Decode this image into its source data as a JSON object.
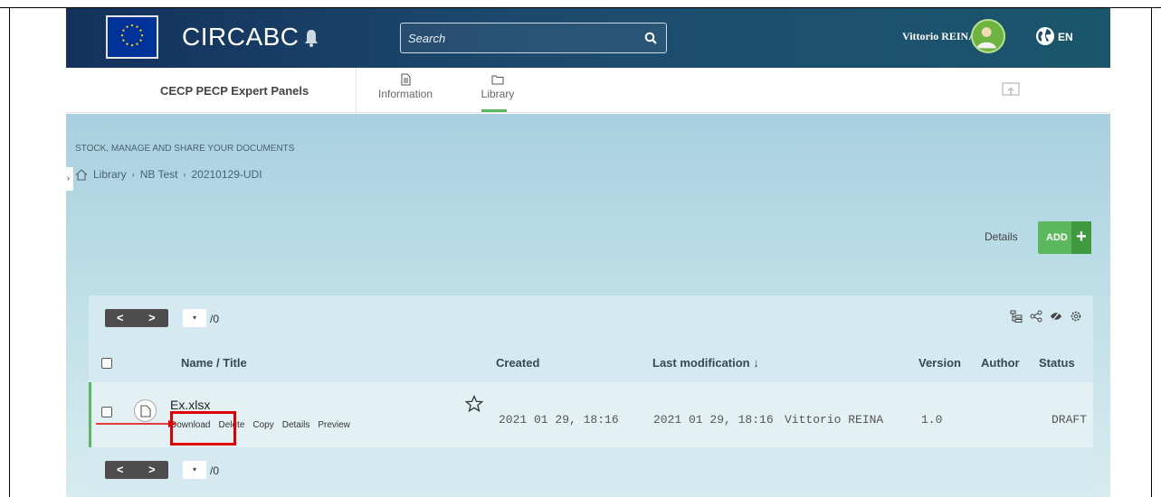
{
  "topbar": {
    "brand": "CIRCABC",
    "search_placeholder": "Search",
    "user_name": "Vittorio REINA",
    "language": "EN",
    "colors": {
      "accent": "#5cb85c",
      "bar": "#16385f"
    }
  },
  "subnav": {
    "group_title": "CECP PECP Expert Panels",
    "tabs": [
      {
        "label": "Information",
        "icon": "document-icon"
      },
      {
        "label": "Library",
        "icon": "folder-icon",
        "active": true
      }
    ]
  },
  "content": {
    "subtitle": "STOCK, MANAGE AND SHARE YOUR DOCUMENTS",
    "breadcrumb": [
      "Library",
      "NB Test",
      "20210129-UDI"
    ],
    "details_label": "Details",
    "add_label": "ADD",
    "add_plus": "+"
  },
  "pager": {
    "page_of": "/0",
    "prev": "<",
    "next": ">",
    "select_arrow": "▾"
  },
  "table": {
    "headers": {
      "name": "Name / Title",
      "created": "Created",
      "modified": "Last modification ↓",
      "version": "Version",
      "author": "Author",
      "status": "Status"
    },
    "rows": [
      {
        "name": "Ex.xlsx",
        "actions": [
          "Download",
          "Delete",
          "Copy",
          "Details",
          "Preview"
        ],
        "created": "2021 01 29, 18:16",
        "modified": "2021 01 29, 18:16",
        "modified_by": "Vittorio REINA",
        "version": "1.0",
        "author": "",
        "status": "DRAFT"
      }
    ]
  }
}
